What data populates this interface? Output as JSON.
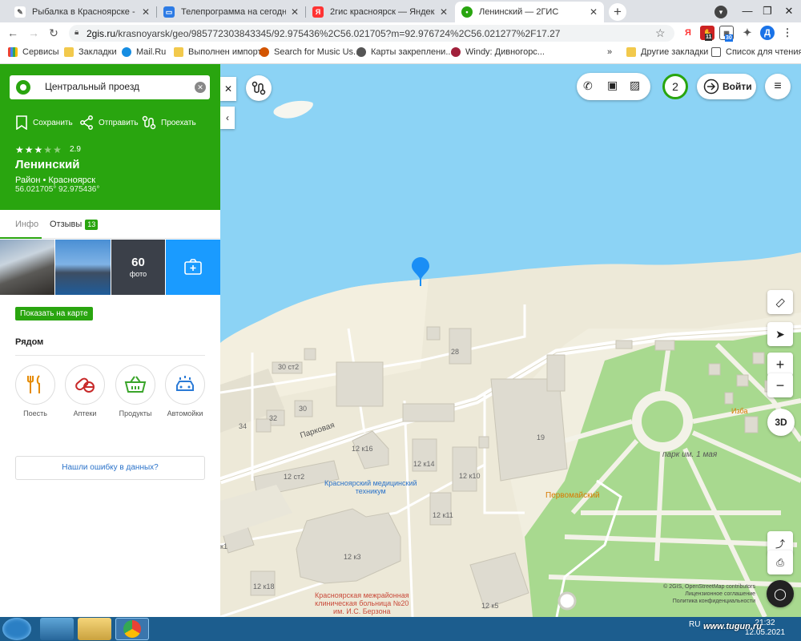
{
  "browser": {
    "tabs": [
      {
        "title": "Рыбалка в Красноярске - ГИМС"
      },
      {
        "title": "Телепрограмма на сегодня и на"
      },
      {
        "title": "2гис красноярск — Яндекс: наш"
      },
      {
        "title": "Ленинский — 2ГИС"
      }
    ],
    "url_domain": "2gis.ru",
    "url_path": "/krasnoyarsk/geo/985772303843345/92.975436%2C56.021705?m=92.976724%2C56.021277%2F17.27",
    "ext_badge_1": "11",
    "ext_badge_2": "30",
    "profile_letter": "Д",
    "bookmarks": [
      {
        "label": "Сервисы"
      },
      {
        "label": "Закладки"
      },
      {
        "label": "Mail.Ru"
      },
      {
        "label": "Выполнен импорт"
      },
      {
        "label": "Search for Music Us..."
      },
      {
        "label": "Карты закреплени..."
      },
      {
        "label": "Windy: Дивногорс..."
      },
      {
        "label": "»"
      },
      {
        "label": "Другие закладки"
      },
      {
        "label": "Список для чтения"
      }
    ]
  },
  "sidebar": {
    "search_value": "Центральный проезд",
    "actions": {
      "save": "Сохранить",
      "send": "Отправить",
      "route": "Проехать"
    },
    "rating": "2.9",
    "rating_stars": 3,
    "place_name": "Ленинский",
    "place_type": "Район • Красноярск",
    "coords": "56.021705° 92.975436°",
    "tab_info": "Инфо",
    "tab_reviews": "Отзывы",
    "reviews_count": "13",
    "photo_count": "60",
    "photo_label": "фото",
    "show_on_map": "Показать на карте",
    "nearby_title": "Рядом",
    "nearby": [
      {
        "label": "Поесть"
      },
      {
        "label": "Аптеки"
      },
      {
        "label": "Продукты"
      },
      {
        "label": "Автомойки"
      }
    ],
    "report_error": "Нашли ошибку в данных?"
  },
  "map": {
    "counter": "2",
    "login": "Войти",
    "zoom_3d": "3D",
    "labels": {
      "street": "Парковая",
      "b28": "28",
      "b30st2": "30 ст2",
      "b30": "30",
      "b32": "32",
      "b34": "34",
      "b19": "19",
      "b12k16": "12 к16",
      "b12k14": "12 к14",
      "b12k10": "12 к10",
      "b12st2": "12 ст2",
      "b12k11": "12 к11",
      "b12k3": "12 к3",
      "b12k18": "12 к18",
      "b12k5": "12 к5",
      "bk1": "к1",
      "park": "парк им. 1 мая",
      "izba": "Изба",
      "pervomay": "Первомайский",
      "college": "Красноярский медицинский\nтехникум",
      "hospital": "Красноярская межрайонная\nклиническая больница №20\nим. И.С. Берзона"
    },
    "copyright": "© 2GIS, OpenStreetMap contributors",
    "license": "Лицензионное соглашение",
    "privacy": "Политика конфиденциальности"
  },
  "taskbar": {
    "lang": "RU",
    "time": "21:32",
    "date": "12.05.2021",
    "watermark": "www.tugun.ru"
  },
  "colors": {
    "brand_green": "#29a50f",
    "water": "#8cd3f5",
    "park": "#a8d98f",
    "accent_blue": "#1a9bff"
  }
}
